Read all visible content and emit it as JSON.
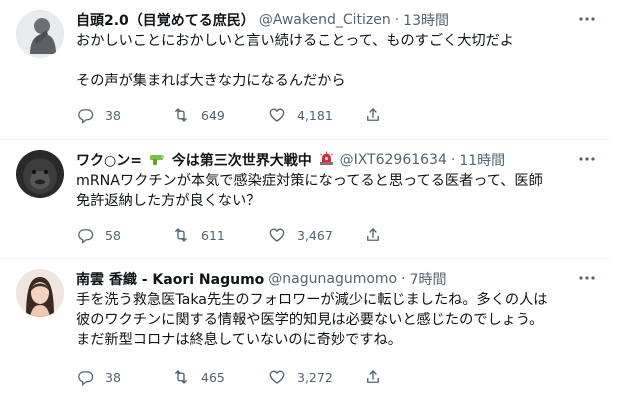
{
  "tweets": [
    {
      "display_name": "自頭2.0（目覚めてる庶民）",
      "handle": "@Awakend_Citizen",
      "separator": "·",
      "time": "13時間",
      "text_lines": [
        "おかしいことにおかしいと言い続けることって、ものすごく大切だよ",
        "",
        "その声が集まれば大きな力になるんだから"
      ],
      "replies": "38",
      "retweets": "649",
      "likes": "4,181",
      "avatar": "statue-thinker-avatar"
    },
    {
      "display_name_pre": "ワク○ン=",
      "display_name_post": " 今は第三次世界大戦中",
      "emoji_1": "water-pistol-icon",
      "emoji_2": "siren-icon",
      "handle": "@IXT62961634",
      "separator": "·",
      "time": "11時間",
      "text_lines": [
        "mRNAワクチンが本気で感染症対策になってると思ってる医者って、医師",
        "免許返納した方が良くない？"
      ],
      "replies": "58",
      "retweets": "611",
      "likes": "3,467",
      "avatar": "gorilla-avatar"
    },
    {
      "display_name": "南雲 香織 - Kaori Nagumo",
      "handle": "@nagunagumomo",
      "separator": "·",
      "time": "7時間",
      "text_lines": [
        "手を洗う救急医Taka先生のフォロワーが減少に転じましたね。多くの人は",
        "彼のワクチンに関する情報や医学的知見は必要ないと感じたのでしょう。",
        "まだ新型コロナは終息していないのに奇妙ですね。"
      ],
      "replies": "38",
      "retweets": "465",
      "likes": "3,272",
      "avatar": "woman-portrait-avatar"
    }
  ],
  "colors": {
    "text": "#0f1419",
    "secondary": "#536471",
    "divider": "#eff3f4"
  }
}
